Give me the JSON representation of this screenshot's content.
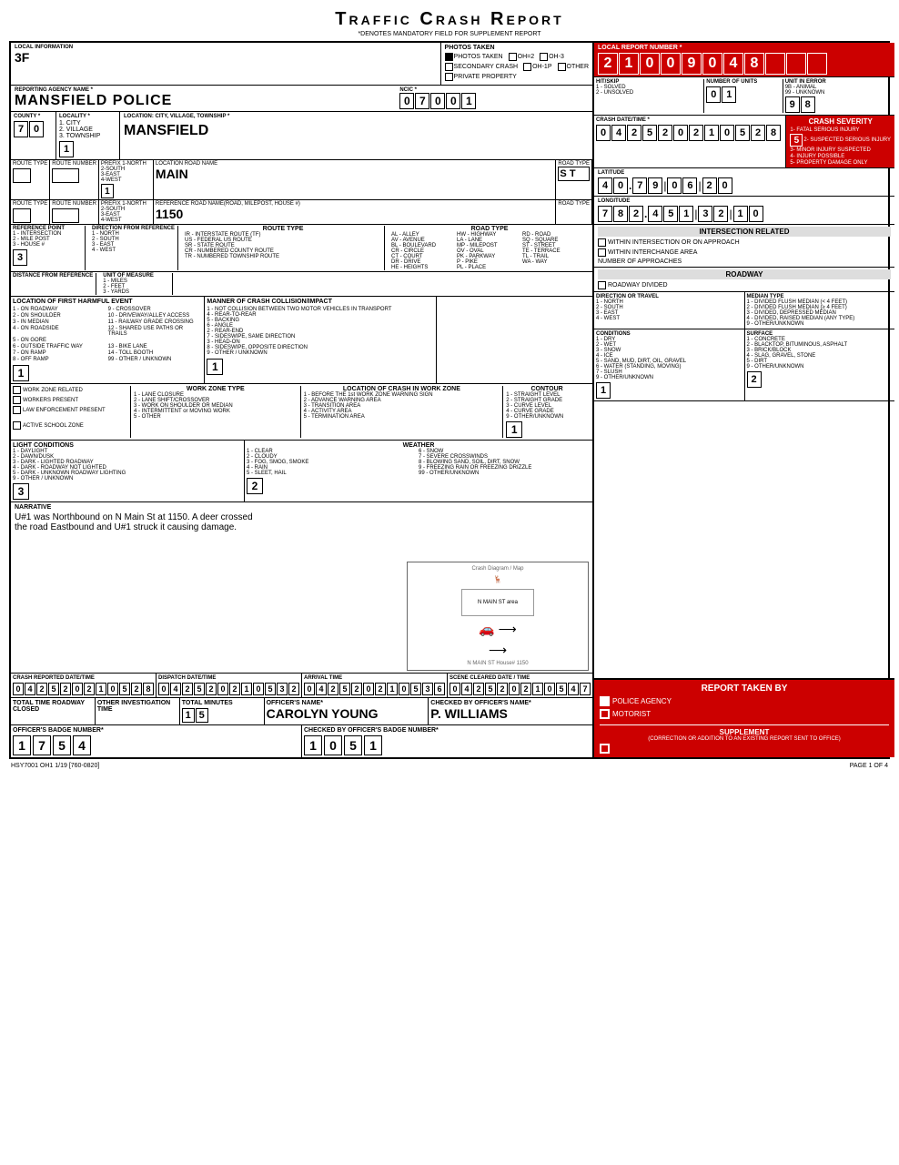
{
  "title": "Traffic Crash Report",
  "subtitle": "*DENOTES MANDATORY FIELD FOR SUPPLEMENT REPORT",
  "local_report_number": {
    "label": "LOCAL REPORT NUMBER *",
    "digits": [
      "2",
      "1",
      "0",
      "0",
      "9",
      "0",
      "4",
      "8",
      "",
      "",
      "",
      "",
      ""
    ]
  },
  "local_info": {
    "label": "LOCAL INFORMATION",
    "value": "3F"
  },
  "photos": {
    "taken": true,
    "oh2": false,
    "oh3": false
  },
  "secondary_crash": false,
  "oh1p": false,
  "other": false,
  "private_property": false,
  "ncic": {
    "label": "NCIC *",
    "digits": [
      "0",
      "7",
      "0",
      "0",
      "1"
    ]
  },
  "reporting_agency": {
    "label": "REPORTING AGENCY NAME *",
    "value": "MANSFIELD POLICE"
  },
  "hit_skip": {
    "label": "HIT/SKIP",
    "solved": "1 - SOLVED",
    "unsolved": "2 - UNSOLVED"
  },
  "num_units": {
    "label": "NUMBER OF UNITS",
    "digits": [
      "0",
      "1"
    ]
  },
  "unit_in_error": {
    "label": "UNIT IN ERROR",
    "options": [
      "9B - ANIMAL",
      "99 - UNKNOWN"
    ],
    "digits": [
      "9",
      "8"
    ]
  },
  "county": {
    "label": "COUNTY *",
    "digits": [
      "7",
      "0"
    ]
  },
  "locality": {
    "label": "LOCALITY *",
    "options": [
      "1. CITY",
      "2. VILLAGE",
      "3. TOWNSHIP"
    ],
    "value": "1"
  },
  "location": {
    "label": "LOCATION: CITY, VILLAGE, TOWNSHIP *",
    "value": "MANSFIELD"
  },
  "crash_datetime": {
    "label": "CRASH DATE/TIME *",
    "digits": [
      "0",
      "4",
      "2",
      "5",
      "2",
      "0",
      "2",
      "1",
      "0",
      "5",
      "2",
      "8"
    ]
  },
  "crash_severity": {
    "label": "CRASH SEVERITY",
    "options": [
      "1- FATAL SERIOUS INJURY",
      "2- SUSPECTED SERIOUS INJURY",
      "3- MINOR INJURY SUSPECTED",
      "4- INJURY POSSIBLE",
      "5- PROPERTY DAMAGE ONLY"
    ],
    "value": "5",
    "selected": "5- PROPERTY DAMAGE ONLY"
  },
  "route_type1": {
    "label": "ROUTE TYPE",
    "value": ""
  },
  "route_number1": {
    "label": "ROUTE NUMBER",
    "value": ""
  },
  "prefix1": {
    "label": "PREFIX 1-NORTH 2-SOUTH 3-EAST 4-WEST",
    "value": "1"
  },
  "road_name": {
    "label": "LOCATION ROAD NAME",
    "value": "MAIN"
  },
  "road_type": {
    "label": "ROAD TYPE",
    "value": "S T"
  },
  "latitude": {
    "label": "LATITUDE",
    "digits": [
      "4",
      "0",
      ".",
      "7",
      "9",
      "|",
      "0",
      "6",
      "|",
      "2",
      "0"
    ]
  },
  "route_type2": {
    "label": "ROUTE TYPE",
    "value": ""
  },
  "route_number2": {
    "label": "ROUTE NUMBER",
    "value": ""
  },
  "prefix2": {
    "label": "PREFIX 1-NORTH 2-SOUTH 3-EAST 4-WEST",
    "value": ""
  },
  "ref_road": {
    "label": "REFERENCE ROAD NAME(ROAD, MILEPOST, HOUSE #)",
    "value": "1150"
  },
  "road_type2": {
    "label": "ROAD TYPE",
    "value": ""
  },
  "longitude": {
    "label": "LONGITUDE",
    "digits": [
      "7",
      "8",
      "2",
      ".",
      "4",
      "5",
      "1",
      "|",
      "3",
      "2",
      "|",
      "1",
      "0"
    ]
  },
  "reference_point": {
    "label": "REFERENCE POINT",
    "options": [
      "1 - INTERSECTION",
      "2 - MILE POST",
      "3 - HOUSE #"
    ],
    "value": "3"
  },
  "direction": {
    "label": "DIRECTION FROM REFERENCE",
    "options": [
      "1 - NORTH",
      "2 - SOUTH",
      "3 - EAST",
      "4 - WEST"
    ]
  },
  "route_type_section": {
    "label": "ROUTE TYPE",
    "options": [
      "IR - INTERSTATE ROUTE (TF)",
      "US - FEDERAL US ROUTE",
      "SR - STATE ROUTE",
      "CR - NUMBERED COUNTY ROUTE",
      "TR - NUMBERED TOWNSHIP ROUTE"
    ]
  },
  "road_type_section": {
    "label": "ROAD TYPE",
    "options": [
      "AL - ALLEY",
      "HW - HIGHWAY",
      "RD - ROAD",
      "AV - AVENUE",
      "LA - LANE",
      "SQ - SQUARE",
      "BL - BOULEVARD",
      "MP - MILEPOST",
      "ST - STREET",
      "CR - CIRCLE",
      "OV - OVAL",
      "TE - TERRACE",
      "CT - COURT",
      "PK - PARKWAY",
      "TL - TRAIL",
      "DR - DRIVE",
      "P - PIKE",
      "WA - WAY",
      "HE - HEIGHTS",
      "PL - PLACE"
    ]
  },
  "distance": {
    "label": "DISTANCE FROM REFERENCE",
    "unit_label": "UNIT OF MEASURE",
    "options": [
      "1 - MILES",
      "2 - FEET",
      "3 - YARDS"
    ]
  },
  "intersection_related": {
    "label": "INTERSECTION RELATED",
    "within_intersection": false,
    "within_interchange": false,
    "num_approaches_label": "NUMBER OF APPROACHES"
  },
  "roadway": {
    "label": "ROADWAY",
    "divided": false
  },
  "location_first_harmful": {
    "label": "LOCATION OF FIRST HARMFUL EVENT",
    "options": [
      "1 - ON ROADWAY",
      "9 - CROSSOVER",
      "2 - ON SHOULDER",
      "10 - DRIVEWAY/ALLEY ACCESS",
      "3 - IN MEDIAN",
      "11 - RAILWAY GRADE CROSSING",
      "4 - ON ROADSIDE",
      "12 - SHARED USE PATHS OR TRAILS",
      "5 - ON GORE",
      "",
      "6 - OUTSIDE TRAFFIC WAY",
      "13 - BIKE LANE",
      "7 - ON RAMP",
      "14 - TOLL BOOTH",
      "8 - OFF RAMP",
      "99 - OTHER / UNKNOWN"
    ],
    "value": "1"
  },
  "manner_of_crash": {
    "label": "MANNER OF CRASH COLLISION/IMPACT",
    "options": [
      "1 - NOT COLLISION BETWEEN TWO MOTOR VEHICLES IN TRANSPORT",
      "4 - REAR-TO-REAR",
      "5 - BACKING",
      "6 - ANGLE",
      "2 - REAR-END",
      "7 - SIDESWIPE, SAME DIRECTION",
      "3 - HEAD-ON",
      "8 - SIDESWIPE, OPPOSITE DIRECTION",
      "9 - OTHER / UNKNOWN"
    ],
    "value": "1"
  },
  "direction_of_travel": {
    "label": "DIRECTION OR TRAVEL",
    "options": [
      "1 - NORTH",
      "2 - SOUTH",
      "3 - EAST",
      "4 - WEST"
    ]
  },
  "median_type": {
    "label": "MEDIAN TYPE",
    "options": [
      "1 - DIVIDED FLUSH MEDIAN (< 4 FEET)",
      "2 - DIVIDED FLUSH MEDIAN (≥ 4 FEET)",
      "3 - DIVIDED, DEPRESSED MEDIAN",
      "4 - DIVIDED, RAISED MEDIAN (ANY TYPE)",
      "9 - OTHER/UNKNOWN"
    ]
  },
  "work_zone": {
    "related": false,
    "workers_present": false,
    "law_enforcement": false,
    "active_school": false,
    "type_options": [
      "1 - LANE CLOSURE",
      "2 - LANE SHIFT/CROSSOVER",
      "3 - WORK ON SHOULDER OR MEDIAN",
      "4 - INTERMITTENT or MOVING WORK",
      "5 - OTHER"
    ],
    "location_options": [
      "1 - BEFORE THE 1st WORK ZONE WARNING SIGN",
      "2 - ADVANCE WARNING AREA",
      "3 - TRANSITION AREA",
      "4 - ACTIVITY AREA",
      "5 - TERMINATION AREA"
    ]
  },
  "contour": {
    "label": "CONTOUR",
    "value": "1",
    "options": [
      "1 - STRAIGHT LEVEL",
      "2 - STRAIGHT GRADE",
      "3 - CURVE LEVEL",
      "4 - CURVE GRADE",
      "9 - OTHER/UNKNOWN"
    ]
  },
  "conditions": {
    "label": "CONDITIONS",
    "value": "1",
    "options": [
      "1 - DRY",
      "2 - WET",
      "3 - SNOW",
      "4 - ICE",
      "5 - SAND, MUD, DIRT, OIL, GRAVEL",
      "6 - WATER (STANDING, MOVING)",
      "7 - SLUSH",
      "9 - OTHER/UNKNOWN"
    ]
  },
  "surface": {
    "label": "SURFACE",
    "value": "2",
    "options": [
      "1 - CONCRETE",
      "2 - BLACKTOP, BITUMINOUS, ASPHALT",
      "3 - BRICK/BLOCK",
      "4 - SLAG, GRAVEL, STONE",
      "5 - DIRT",
      "9 - OTHER/UNKNOWN"
    ]
  },
  "light_conditions": {
    "label": "LIGHT CONDITIONS",
    "value": "3",
    "options": [
      "1 - DAYLIGHT",
      "2 - DAWN/DUSK",
      "3 - DARK - LIGHTED ROADWAY",
      "4 - DARK - ROADWAY NOT LIGHTED",
      "5 - DARK - UNKNOWN ROADWAY LIGHTING",
      "9 - OTHER / UNKNOWN"
    ]
  },
  "weather": {
    "label": "WEATHER",
    "value": "2",
    "options": [
      "1 - CLEAR",
      "6 - SNOW",
      "2 - CLOUDY",
      "7 - SEVERE CROSSWINDS",
      "3 - FOG, SMOG, SMOKE",
      "8 - BLOWING SAND, SOIL, DIRT, SNOW",
      "4 - RAIN",
      "9 - FREEZING RAIN OR FREEZING DRIZZLE",
      "5 - SLEET, HAIL",
      "99 - OTHER/UNKNOWN"
    ]
  },
  "narrative": {
    "label": "NARRATIVE",
    "text": "U#1 was Northbound on N Main St at 1150.  A deer crossed\nthe road Eastbound and U#1 struck it causing damage."
  },
  "crash_reported_datetime": {
    "label": "CRASH REPORTED DATE/TIME",
    "digits": [
      "0",
      "4",
      "2",
      "5",
      "2",
      "0",
      "2",
      "1",
      "0",
      "5",
      "2",
      "8"
    ]
  },
  "dispatch_datetime": {
    "label": "DISPATCH DATE/TIME",
    "digits": [
      "0",
      "4",
      "2",
      "5",
      "2",
      "0",
      "2",
      "1",
      "0",
      "5",
      "3",
      "2"
    ]
  },
  "arrival_time": {
    "label": "ARRIVAL TIME",
    "digits": [
      "0",
      "4",
      "2",
      "5",
      "2",
      "0",
      "2",
      "1",
      "0",
      "5",
      "3",
      "6"
    ]
  },
  "scene_cleared": {
    "label": "SCENE CLEARED DATE / TIME",
    "digits": [
      "0",
      "4",
      "2",
      "5",
      "2",
      "0",
      "2",
      "1",
      "0",
      "5",
      "4",
      "7"
    ]
  },
  "report_taken_by": {
    "label": "REPORT TAKEN BY",
    "police_agency": true,
    "motorist": false,
    "supplement": false
  },
  "total_time": {
    "label": "TOTAL TIME ROADWAY CLOSED",
    "value": ""
  },
  "other_investigation": {
    "label": "OTHER INVESTIGATION TIME",
    "value": ""
  },
  "total_minutes": {
    "label": "TOTAL MINUTES",
    "value": "1 5"
  },
  "officer_name": {
    "label": "OFFICER'S NAME*",
    "value": "CAROLYN YOUNG"
  },
  "checked_by": {
    "label": "CHECKED BY OFFICER'S NAME*",
    "value": "P. WILLIAMS"
  },
  "badge_number": {
    "label": "OFFICER'S BADGE NUMBER*",
    "digits": [
      "1",
      "7",
      "5",
      "4"
    ]
  },
  "checked_badge": {
    "label": "CHECKED BY OFFICER'S BADGE NUMBER*",
    "digits": [
      "1",
      "0",
      "5",
      "1"
    ]
  },
  "form_number": "HSY7001 OH1 1/19 [760-0820]",
  "page_info": "PAGE 1 OF 4"
}
